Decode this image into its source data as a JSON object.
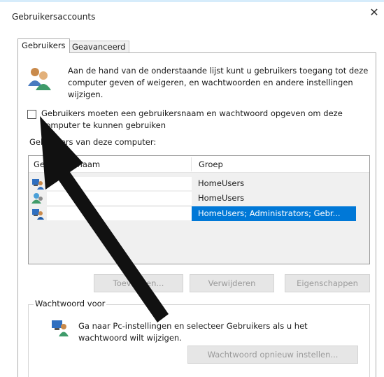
{
  "window": {
    "title": "Gebruikersaccounts",
    "close_glyph": "✕"
  },
  "tabs": [
    {
      "label": "Gebruikers",
      "active": true
    },
    {
      "label": "Geavanceerd",
      "active": false
    }
  ],
  "intro_text": "Aan de hand van de onderstaande lijst kunt u gebruikers toegang tot deze computer geven of weigeren, en wachtwoorden en andere instellingen wijzigen.",
  "require_login": {
    "label": "Gebruikers moeten een gebruikersnaam en wachtwoord opgeven om deze computer te kunnen gebruiken",
    "checked": false
  },
  "users_list": {
    "label": "Gebruikers van deze computer:",
    "columns": [
      "Gebruikersnaam",
      "Groep"
    ],
    "rows": [
      {
        "name": "",
        "group": "HomeUsers",
        "icon": "user-icon",
        "selected": false
      },
      {
        "name": "",
        "group": "HomeUsers",
        "icon": "user-icon",
        "selected": false
      },
      {
        "name": "",
        "group": "HomeUsers; Administrators; Gebr...",
        "icon": "admin-user-icon",
        "selected": true
      }
    ]
  },
  "buttons": {
    "add": "Toevoegen...",
    "remove": "Verwijderen",
    "properties": "Eigenschappen"
  },
  "password_group": {
    "legend": "Wachtwoord voor",
    "text": "Ga naar Pc-instellingen en selecteer Gebruikers als u het wachtwoord wilt wijzigen.",
    "reset_button": "Wachtwoord opnieuw instellen..."
  },
  "colors": {
    "selection": "#0078d7",
    "annotation_arrow": "#111111"
  }
}
